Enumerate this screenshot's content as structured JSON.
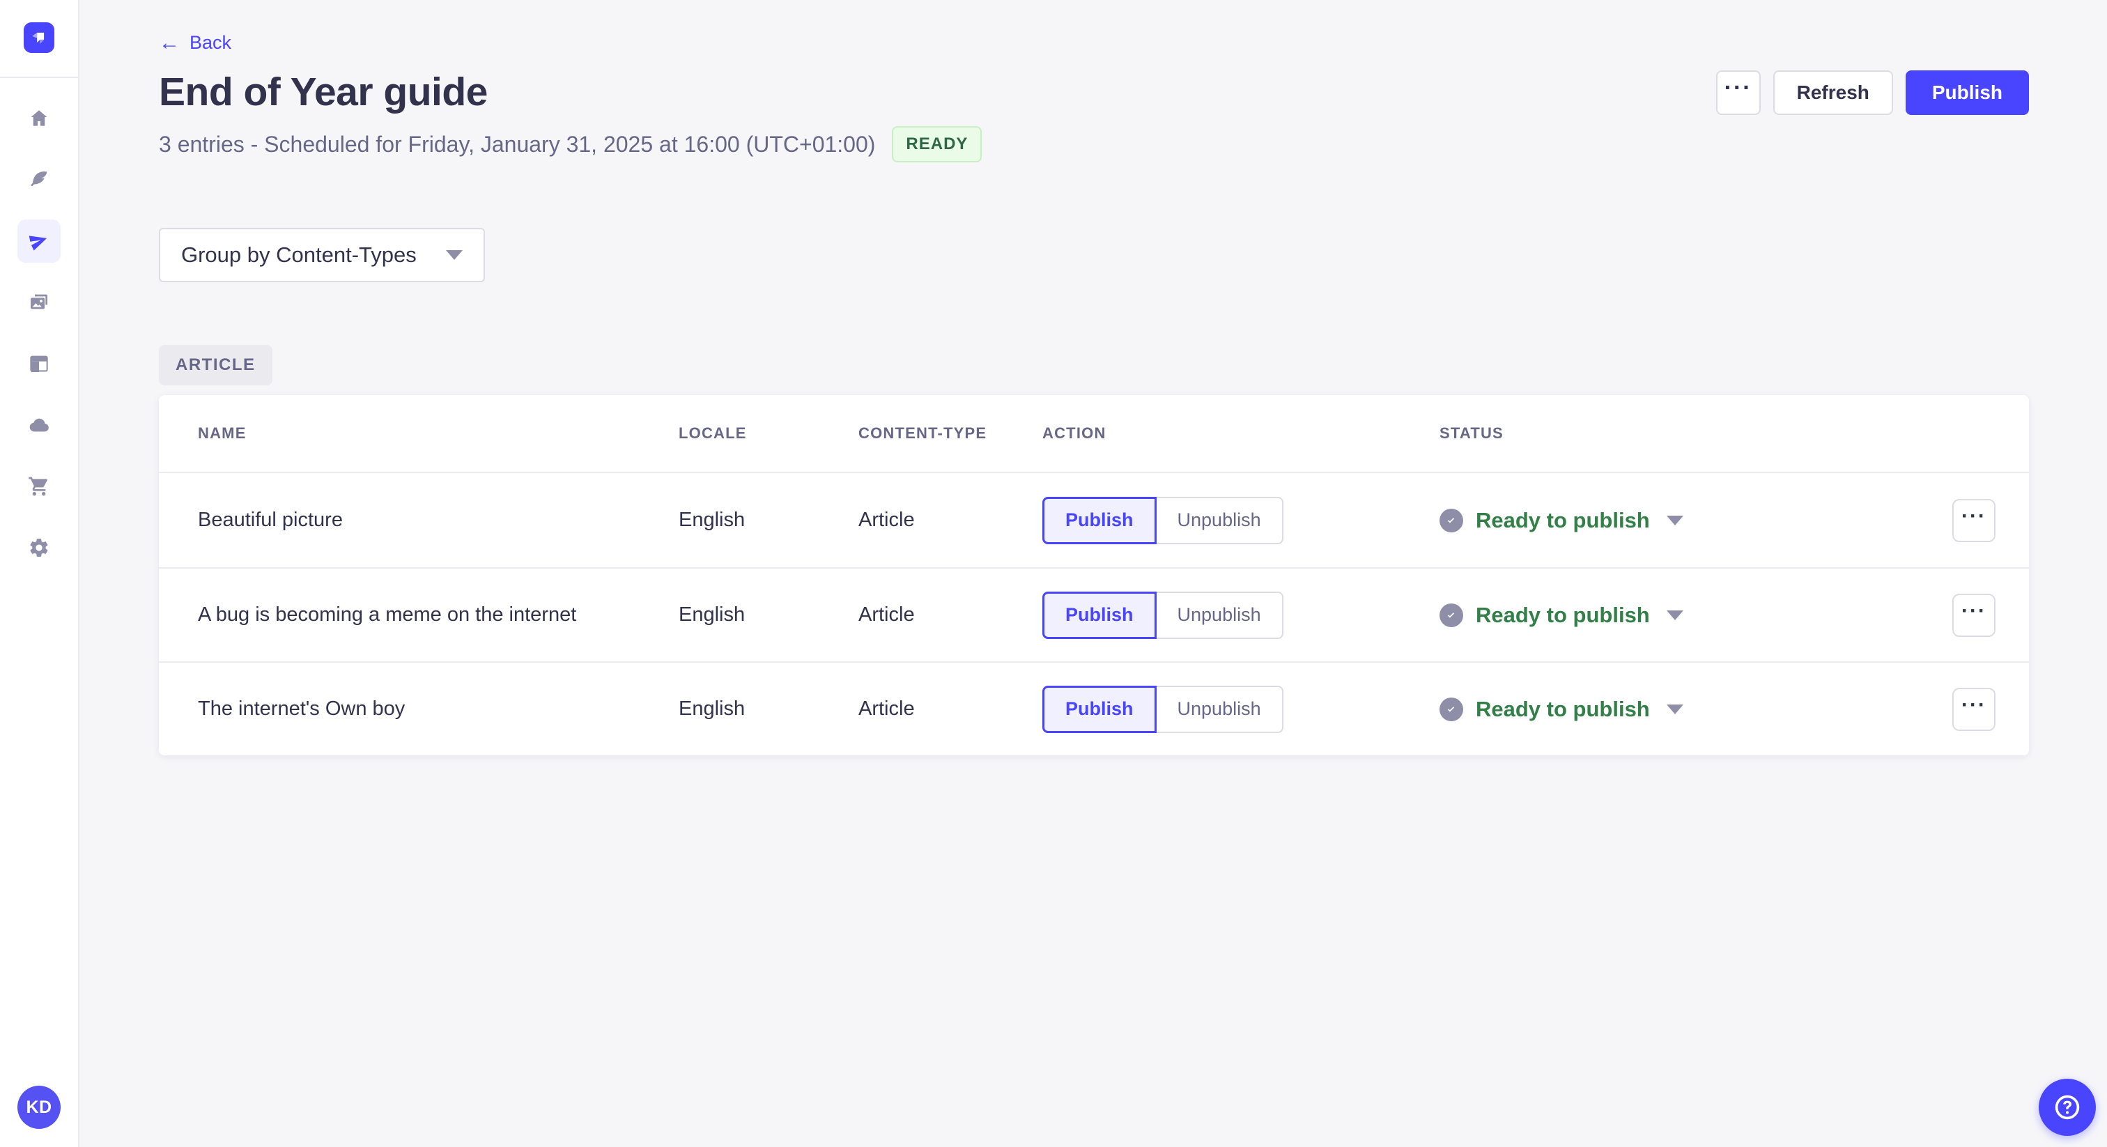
{
  "colors": {
    "primary": "#4945ff",
    "primary_light": "#f0f0ff",
    "success_badge_bg": "#eafbe7",
    "success_badge_text": "#2f6846",
    "status_green": "#328048",
    "page_bg": "#f6f6f9",
    "neutral_icon": "#8e8ea9"
  },
  "sidebar": {
    "logo_icon": "strapi-logo",
    "items": [
      {
        "icon": "home-icon",
        "active": false
      },
      {
        "icon": "feather-icon",
        "active": false
      },
      {
        "icon": "paper-plane-icon",
        "active": true
      },
      {
        "icon": "media-library-icon",
        "active": false
      },
      {
        "icon": "layout-icon",
        "active": false
      },
      {
        "icon": "cloud-icon",
        "active": false
      },
      {
        "icon": "cart-icon",
        "active": false
      },
      {
        "icon": "gear-icon",
        "active": false
      }
    ],
    "avatar_initials": "KD"
  },
  "header": {
    "back_arrow": "←",
    "back_label": "Back",
    "title": "End of Year guide",
    "subtitle": "3 entries - Scheduled for Friday, January 31, 2025 at 16:00 (UTC+01:00)",
    "status_badge": "READY",
    "actions": {
      "more": "···",
      "refresh": "Refresh",
      "publish": "Publish"
    }
  },
  "toolbar": {
    "group_by": "Group by Content-Types"
  },
  "content_group": {
    "badge": "ARTICLE"
  },
  "table": {
    "headers": {
      "name": "NAME",
      "locale": "LOCALE",
      "content_type": "CONTENT-TYPE",
      "action": "ACTION",
      "status": "STATUS"
    },
    "action_buttons": {
      "publish": "Publish",
      "unpublish": "Unpublish"
    },
    "row_more": "···",
    "rows": [
      {
        "name": "Beautiful picture",
        "locale": "English",
        "content_type": "Article",
        "status": "Ready to publish"
      },
      {
        "name": "A bug is becoming a meme on the internet",
        "locale": "English",
        "content_type": "Article",
        "status": "Ready to publish"
      },
      {
        "name": "The internet's Own boy",
        "locale": "English",
        "content_type": "Article",
        "status": "Ready to publish"
      }
    ]
  },
  "help": {
    "icon": "question-mark-icon"
  }
}
